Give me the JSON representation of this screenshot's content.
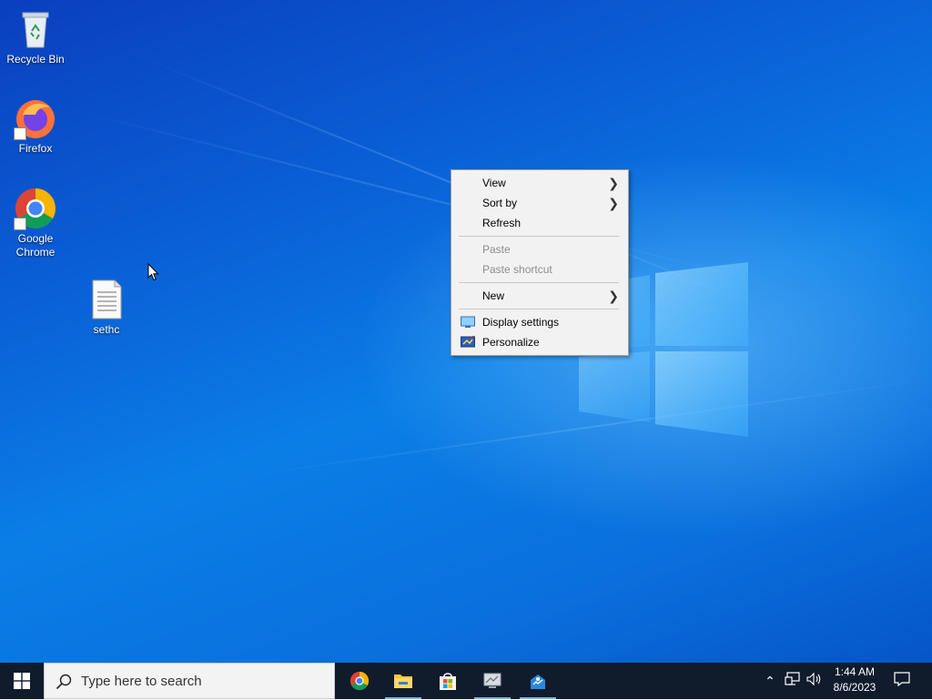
{
  "desktop": {
    "icons": [
      {
        "label": "Recycle Bin",
        "icon": "recycle-bin-icon"
      },
      {
        "label": "Firefox",
        "icon": "firefox-icon"
      },
      {
        "label": "Google Chrome",
        "icon": "chrome-icon"
      },
      {
        "label": "sethc",
        "icon": "text-file-icon"
      }
    ],
    "accent_color": "#0a6fdc"
  },
  "context_menu": {
    "items": [
      {
        "label": "View",
        "has_submenu": true,
        "enabled": true
      },
      {
        "label": "Sort by",
        "has_submenu": true,
        "enabled": true
      },
      {
        "label": "Refresh",
        "has_submenu": false,
        "enabled": true
      },
      {
        "label": "Paste",
        "has_submenu": false,
        "enabled": false
      },
      {
        "label": "Paste shortcut",
        "has_submenu": false,
        "enabled": false
      },
      {
        "label": "New",
        "has_submenu": true,
        "enabled": true
      },
      {
        "label": "Display settings",
        "has_submenu": false,
        "enabled": true,
        "icon": "display-settings-icon"
      },
      {
        "label": "Personalize",
        "has_submenu": false,
        "enabled": true,
        "icon": "personalize-icon"
      }
    ]
  },
  "taskbar": {
    "search_placeholder": "Type here to search",
    "apps": [
      {
        "name": "Google Chrome",
        "icon": "chrome-icon",
        "running": false
      },
      {
        "name": "File Explorer",
        "icon": "file-explorer-icon",
        "running": true
      },
      {
        "name": "Microsoft Store",
        "icon": "store-icon",
        "running": false
      },
      {
        "name": "Remote app",
        "icon": "remote-desktop-icon",
        "running": true
      },
      {
        "name": "App",
        "icon": "app-icon",
        "running": true
      }
    ],
    "tray_icons": [
      "chevron-up-icon",
      "network-icon",
      "volume-icon"
    ],
    "clock": {
      "time": "1:44 AM",
      "date": "8/6/2023"
    },
    "background_color": "#101c2c"
  }
}
